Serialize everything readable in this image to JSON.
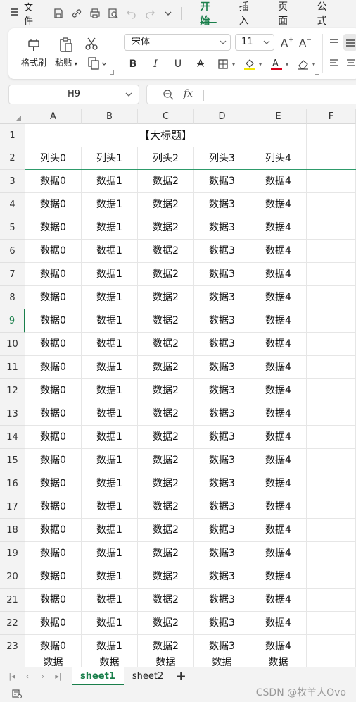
{
  "menubar": {
    "file_label": "文件",
    "tabs": [
      "开始",
      "插入",
      "页面",
      "公式"
    ]
  },
  "ribbon": {
    "format_painter": "格式刷",
    "paste": "粘贴",
    "font_name": "宋体",
    "font_size": "11"
  },
  "formula_bar": {
    "cell_ref": "H9",
    "fx": "fx",
    "content": ""
  },
  "sheet": {
    "columns": [
      "A",
      "B",
      "C",
      "D",
      "E",
      "F"
    ],
    "title": "【大标题】",
    "headers": [
      "列头0",
      "列头1",
      "列头2",
      "列头3",
      "列头4"
    ],
    "row_numbers": [
      "1",
      "2",
      "3",
      "4",
      "5",
      "6",
      "7",
      "8",
      "9",
      "10",
      "11",
      "12",
      "13",
      "14",
      "15",
      "16",
      "17",
      "18",
      "19",
      "20",
      "21",
      "22",
      "23"
    ],
    "data_row": [
      "数据0",
      "数据1",
      "数据2",
      "数据3",
      "数据4"
    ],
    "data_rows_count_visible": 21,
    "partial_row_text": "数据",
    "selected_row": "9"
  },
  "sheet_tabs": [
    "sheet1",
    "sheet2"
  ],
  "active_sheet": "sheet1",
  "watermark": "CSDN @牧羊人Ovo",
  "colors": {
    "accent": "#1a7f4b",
    "freeze_line": "#2e9b6b",
    "header_bg": "#f3f3f3"
  }
}
